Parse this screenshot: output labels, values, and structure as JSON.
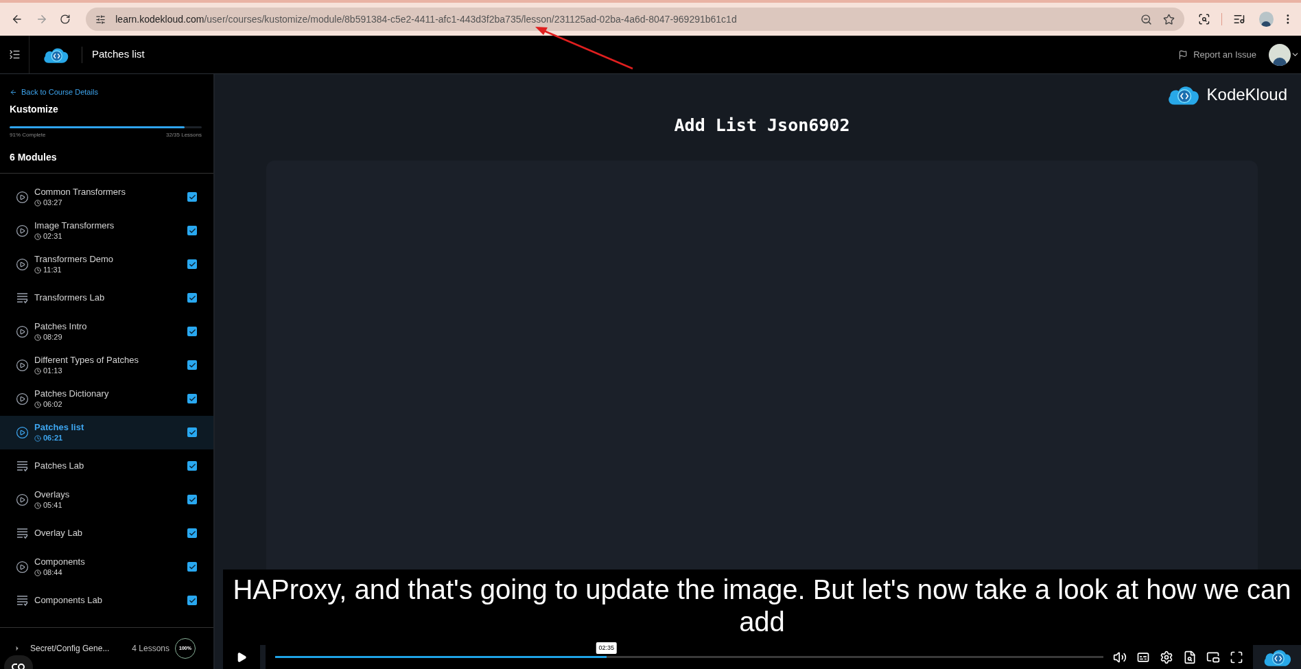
{
  "browser": {
    "url_host": "learn.kodekloud.com",
    "url_path": "/user/courses/kustomize/module/8b591384-c5e2-4411-afc1-443d3f2ba735/lesson/231125ad-02ba-4a6d-8047-969291b61c1d"
  },
  "header": {
    "title": "Patches list",
    "report": "Report an Issue"
  },
  "sidebar": {
    "back": "Back to Course Details",
    "course": "Kustomize",
    "progress": {
      "level": 0.91,
      "complete": "91% Complete",
      "lessons": "32/35 Lessons"
    },
    "modules_heading": "6 Modules",
    "lessons": [
      {
        "kind": "video",
        "title": "Common Transformers",
        "duration": "03:27",
        "checked": true,
        "selected": false
      },
      {
        "kind": "video",
        "title": "Image Transformers",
        "duration": "02:31",
        "checked": true,
        "selected": false
      },
      {
        "kind": "video",
        "title": "Transformers Demo",
        "duration": "11:31",
        "checked": true,
        "selected": false
      },
      {
        "kind": "lab",
        "title": "Transformers Lab",
        "checked": true,
        "selected": false
      },
      {
        "kind": "video",
        "title": "Patches Intro",
        "duration": "08:29",
        "checked": true,
        "selected": false
      },
      {
        "kind": "video",
        "title": "Different Types of Patches",
        "duration": "01:13",
        "checked": true,
        "selected": false
      },
      {
        "kind": "video",
        "title": "Patches Dictionary",
        "duration": "06:02",
        "checked": true,
        "selected": false
      },
      {
        "kind": "video",
        "title": "Patches list",
        "duration": "06:21",
        "checked": true,
        "selected": true
      },
      {
        "kind": "lab",
        "title": "Patches Lab",
        "checked": true,
        "selected": false
      },
      {
        "kind": "video",
        "title": "Overlays",
        "duration": "05:41",
        "checked": true,
        "selected": false
      },
      {
        "kind": "lab",
        "title": "Overlay Lab",
        "checked": true,
        "selected": false
      },
      {
        "kind": "video",
        "title": "Components",
        "duration": "08:44",
        "checked": true,
        "selected": false
      },
      {
        "kind": "lab",
        "title": "Components Lab",
        "checked": true,
        "selected": false
      }
    ],
    "next_module": {
      "name": "Secret/Config Gene...",
      "count": "4 Lessons",
      "percent": "100%"
    }
  },
  "lesson": {
    "title": "Add List Json6902",
    "brand": "KodeKloud",
    "caption": "HAProxy, and that's going to update the image. But let's now take a look at how we can add",
    "player": {
      "level": 0.4,
      "time": "02:35"
    }
  }
}
